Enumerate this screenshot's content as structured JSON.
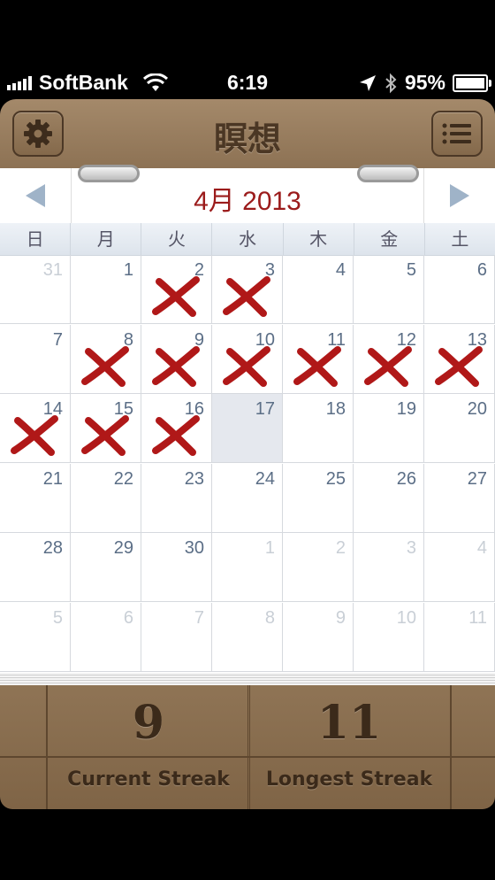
{
  "status_bar": {
    "carrier": "SoftBank",
    "time": "6:19",
    "battery": "95%",
    "battery_level": 0.95
  },
  "header": {
    "title": "瞑想",
    "settings_icon": "gear-icon",
    "menu_icon": "list-icon"
  },
  "calendar": {
    "month_label": "4月 2013",
    "prev_icon": "triangle-left-icon",
    "next_icon": "triangle-right-icon",
    "weekdays": [
      "日",
      "月",
      "火",
      "水",
      "木",
      "金",
      "土"
    ],
    "days": [
      {
        "n": "31",
        "out": true,
        "mark": false
      },
      {
        "n": "1",
        "out": false,
        "mark": false
      },
      {
        "n": "2",
        "out": false,
        "mark": true
      },
      {
        "n": "3",
        "out": false,
        "mark": true
      },
      {
        "n": "4",
        "out": false,
        "mark": false
      },
      {
        "n": "5",
        "out": false,
        "mark": false
      },
      {
        "n": "6",
        "out": false,
        "mark": false
      },
      {
        "n": "7",
        "out": false,
        "mark": false
      },
      {
        "n": "8",
        "out": false,
        "mark": true
      },
      {
        "n": "9",
        "out": false,
        "mark": true
      },
      {
        "n": "10",
        "out": false,
        "mark": true
      },
      {
        "n": "11",
        "out": false,
        "mark": true
      },
      {
        "n": "12",
        "out": false,
        "mark": true
      },
      {
        "n": "13",
        "out": false,
        "mark": true
      },
      {
        "n": "14",
        "out": false,
        "mark": true
      },
      {
        "n": "15",
        "out": false,
        "mark": true
      },
      {
        "n": "16",
        "out": false,
        "mark": true
      },
      {
        "n": "17",
        "out": false,
        "mark": false,
        "today": true
      },
      {
        "n": "18",
        "out": false,
        "mark": false
      },
      {
        "n": "19",
        "out": false,
        "mark": false
      },
      {
        "n": "20",
        "out": false,
        "mark": false
      },
      {
        "n": "21",
        "out": false,
        "mark": false
      },
      {
        "n": "22",
        "out": false,
        "mark": false
      },
      {
        "n": "23",
        "out": false,
        "mark": false
      },
      {
        "n": "24",
        "out": false,
        "mark": false
      },
      {
        "n": "25",
        "out": false,
        "mark": false
      },
      {
        "n": "26",
        "out": false,
        "mark": false
      },
      {
        "n": "27",
        "out": false,
        "mark": false
      },
      {
        "n": "28",
        "out": false,
        "mark": false
      },
      {
        "n": "29",
        "out": false,
        "mark": false
      },
      {
        "n": "30",
        "out": false,
        "mark": false
      },
      {
        "n": "1",
        "out": true,
        "mark": false
      },
      {
        "n": "2",
        "out": true,
        "mark": false
      },
      {
        "n": "3",
        "out": true,
        "mark": false
      },
      {
        "n": "4",
        "out": true,
        "mark": false
      },
      {
        "n": "5",
        "out": true,
        "mark": false
      },
      {
        "n": "6",
        "out": true,
        "mark": false
      },
      {
        "n": "7",
        "out": true,
        "mark": false
      },
      {
        "n": "8",
        "out": true,
        "mark": false
      },
      {
        "n": "9",
        "out": true,
        "mark": false
      },
      {
        "n": "10",
        "out": true,
        "mark": false
      },
      {
        "n": "11",
        "out": true,
        "mark": false
      }
    ]
  },
  "footer": {
    "current_streak_value": "9",
    "current_streak_label": "Current Streak",
    "longest_streak_value": "11",
    "longest_streak_label": "Longest Streak"
  },
  "colors": {
    "accent_red": "#9b1b1b",
    "wood": "#8d7254"
  }
}
